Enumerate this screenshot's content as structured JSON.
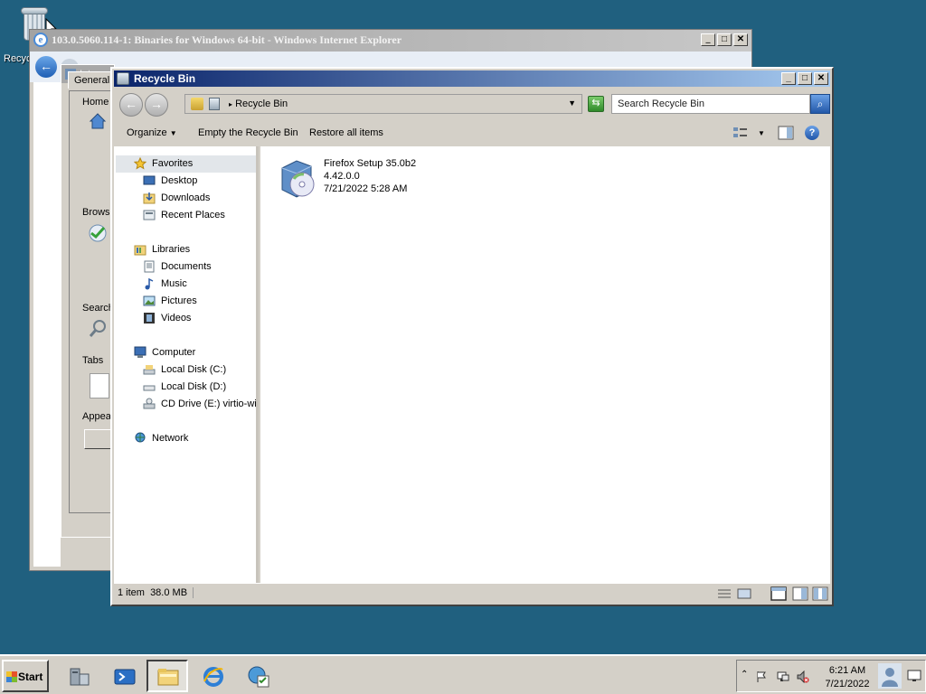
{
  "desktop": {
    "recycle_bin_label": "Recyc"
  },
  "ie_window": {
    "title": "103.0.5060.114-1: Binaries for Windows 64-bit - Windows Internet Explorer",
    "inet_options_title": "Intern",
    "tab_general": "General",
    "home_label": "Home p",
    "browsing_label": "Brows",
    "search_label": "Search",
    "tabs_label": "Tabs",
    "appearance_label": "Appea"
  },
  "recycle_bin": {
    "title": "Recycle Bin",
    "address_crumb": "Recycle Bin",
    "search_placeholder": "Search Recycle Bin",
    "toolbar": {
      "organize": "Organize",
      "empty": "Empty the Recycle Bin",
      "restore": "Restore all items"
    },
    "nav": {
      "favorites": "Favorites",
      "desktop": "Desktop",
      "downloads": "Downloads",
      "recent": "Recent Places",
      "libraries": "Libraries",
      "documents": "Documents",
      "music": "Music",
      "pictures": "Pictures",
      "videos": "Videos",
      "computer": "Computer",
      "disk_c": "Local Disk (C:)",
      "disk_d": "Local Disk (D:)",
      "cd_drive": "CD Drive (E:) virtio-win",
      "network": "Network"
    },
    "file": {
      "name": "Firefox Setup 35.0b2",
      "version": "4.42.0.0",
      "date": "7/21/2022 5:28 AM"
    },
    "status": "1 item  38.0 MB"
  },
  "taskbar": {
    "start": "Start",
    "time": "6:21 AM",
    "date": "7/21/2022"
  }
}
